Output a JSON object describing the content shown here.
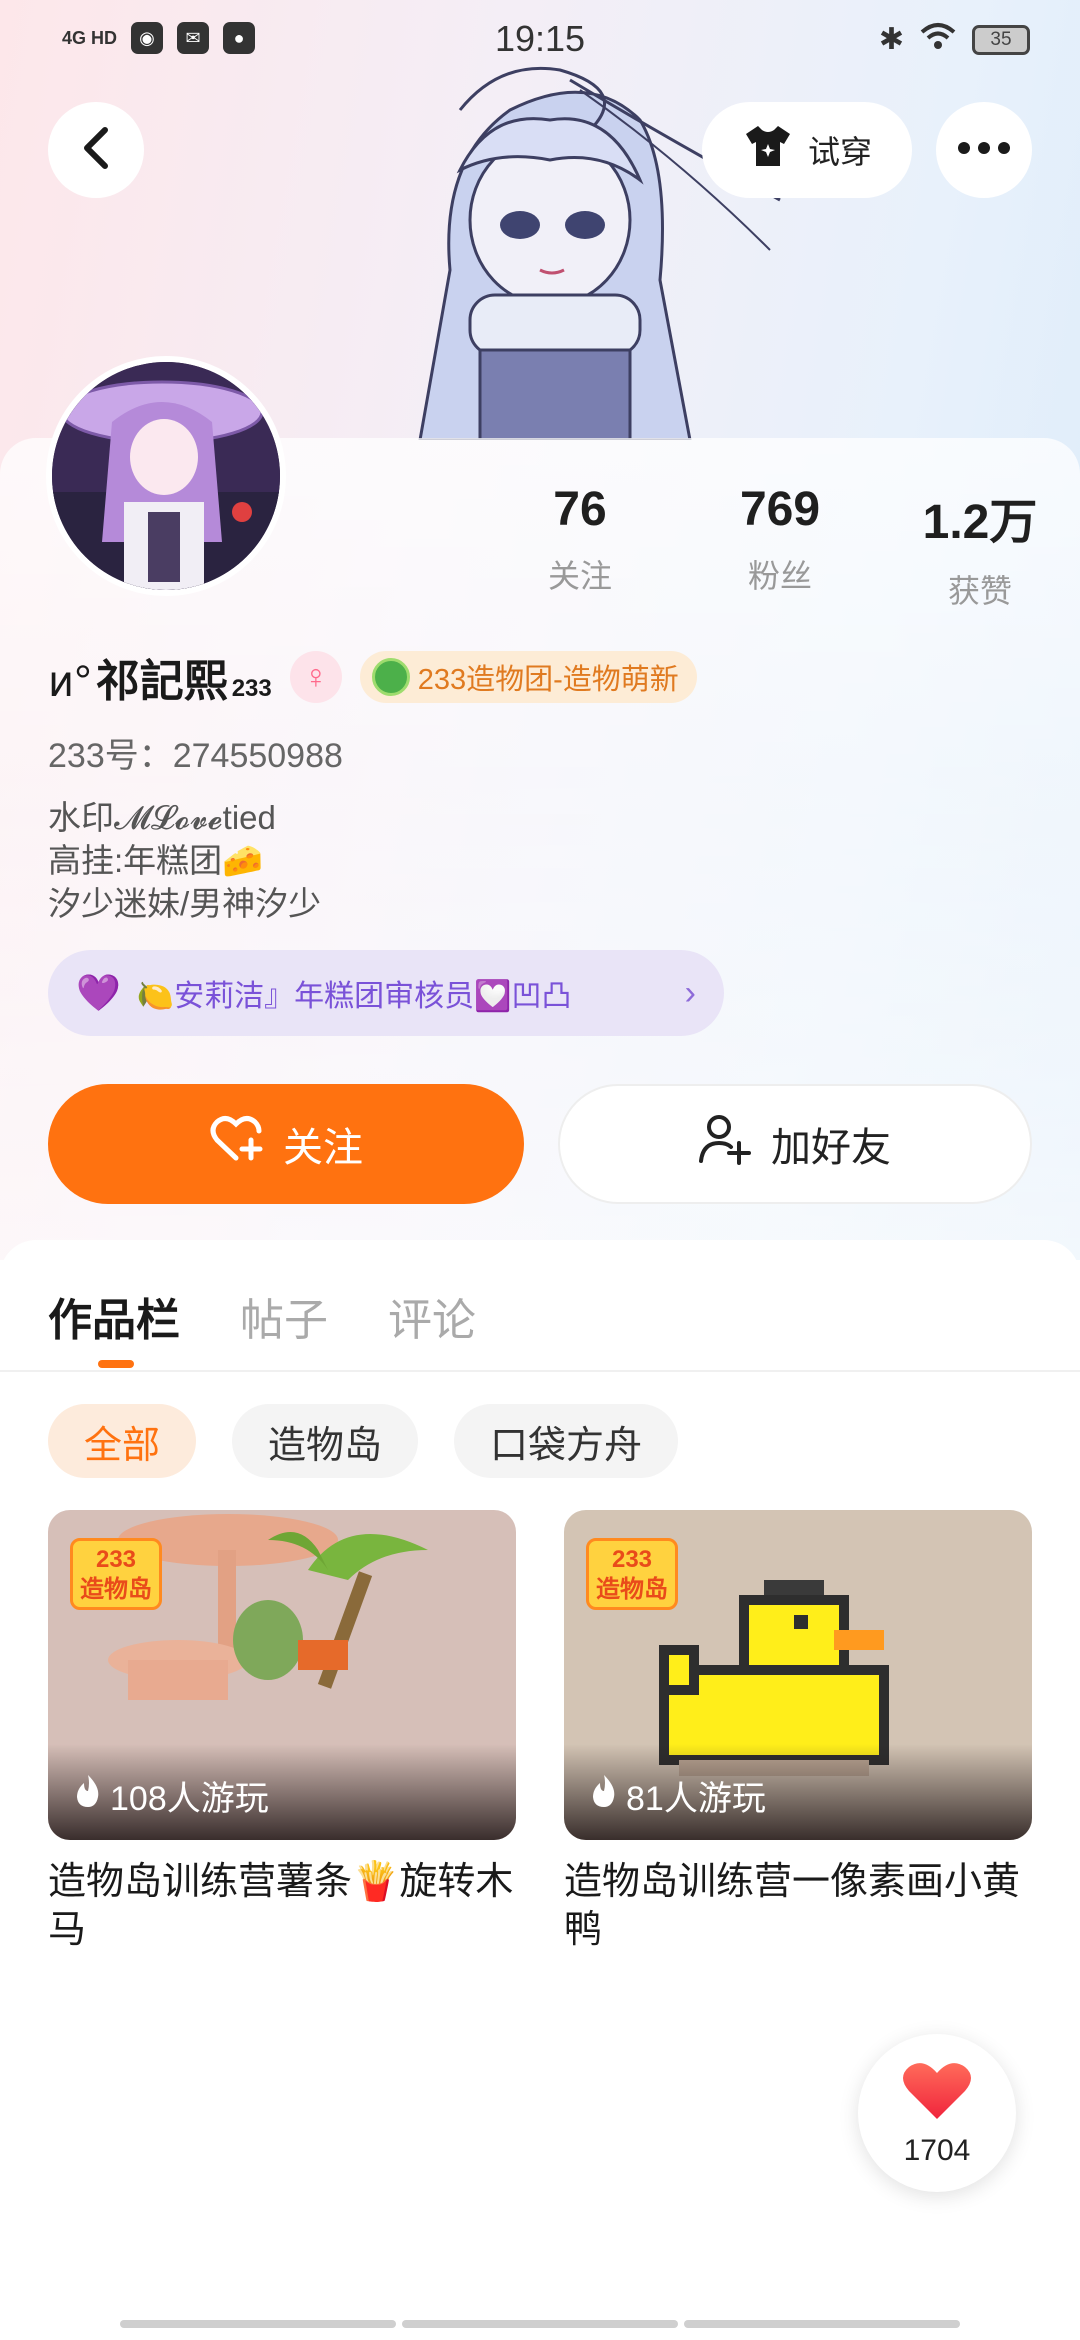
{
  "status_bar": {
    "time": "19:15",
    "network": "4G HD",
    "battery": "35"
  },
  "header": {
    "try_on_label": "试穿"
  },
  "stats": [
    {
      "value": "76",
      "label": "关注"
    },
    {
      "value": "769",
      "label": "粉丝"
    },
    {
      "value": "1.2万",
      "label": "获赞"
    }
  ],
  "profile": {
    "name_prefix": "𐑍°",
    "name": "祁記熙",
    "name_sup": "233",
    "gender_symbol": "♀",
    "badge": "233造物团-造物萌新",
    "uid": "233号：274550988",
    "bio": [
      "水印𝓜𝓛𝓸𝓿𝓮tied",
      "高挂:年糕团🧀",
      "汐少迷妹/男神汐少"
    ],
    "club": "🍋安莉洁』年糕团审核员💟凹凸"
  },
  "actions": {
    "follow_label": "关注",
    "add_friend_label": "加好友"
  },
  "tabs": [
    {
      "label": "作品栏",
      "active": true
    },
    {
      "label": "帖子",
      "active": false
    },
    {
      "label": "评论",
      "active": false
    }
  ],
  "chips": [
    {
      "label": "全部",
      "active": true
    },
    {
      "label": "造物岛",
      "active": false
    },
    {
      "label": "口袋方舟",
      "active": false
    }
  ],
  "works": [
    {
      "plays": "108人游玩",
      "title": "造物岛训练营薯条🍟旋转木马",
      "logo": "233\n造物岛"
    },
    {
      "plays": "81人游玩",
      "title": "造物岛训练营一像素画小黄鸭",
      "logo": "233\n造物岛"
    }
  ],
  "like_fab": {
    "count": "1704"
  },
  "colors": {
    "accent": "#ff7210",
    "club": "#7a52d8"
  }
}
